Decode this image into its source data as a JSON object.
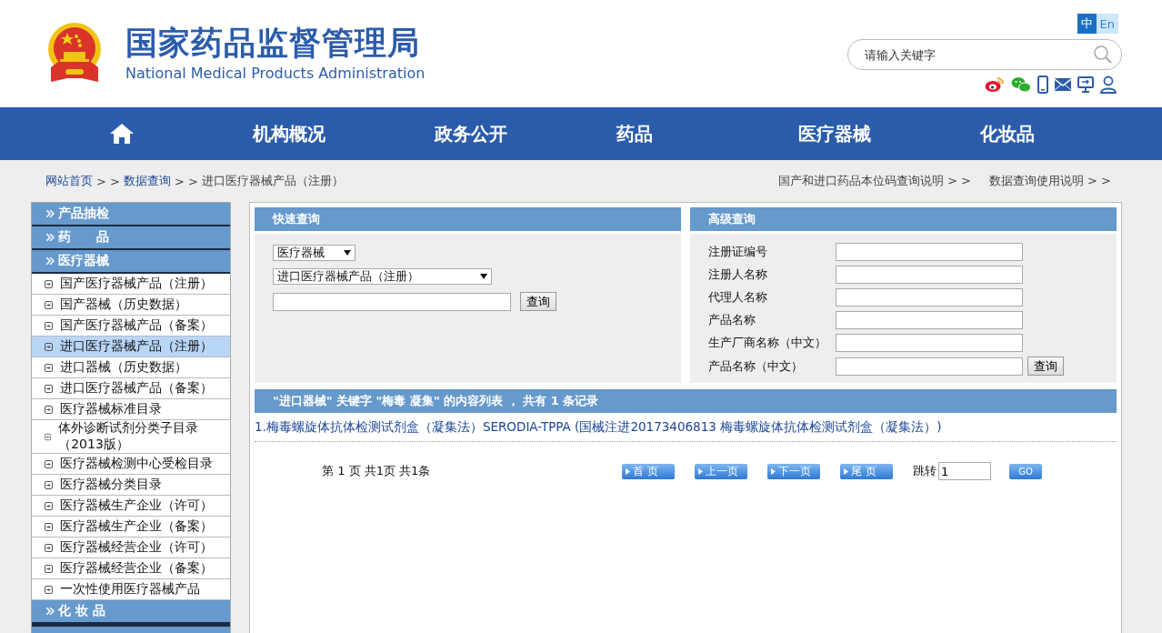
{
  "header": {
    "title": "国家药品监督管理局",
    "subtitle": "National Medical Products Administration",
    "languages": [
      {
        "label": "中",
        "selected": true
      },
      {
        "label": "En",
        "selected": false
      }
    ],
    "search": {
      "placeholder": "请输入关键字"
    }
  },
  "nav": {
    "items": [
      {
        "label": "机构概况"
      },
      {
        "label": "政务公开"
      },
      {
        "label": "药品"
      },
      {
        "label": "医疗器械"
      },
      {
        "label": "化妆品"
      }
    ]
  },
  "breadcrumb": [
    {
      "label": "网站首页",
      "kind": "link",
      "suffix": "> >"
    },
    {
      "label": "数据查询",
      "kind": "link",
      "suffix": "> >"
    },
    {
      "label": "进口医疗器械产品（注册）",
      "kind": "current"
    }
  ],
  "help_links": [
    {
      "label": "国产和进口药品本位码查询说明 > >"
    },
    {
      "label": "数据查询使用说明 > >"
    }
  ],
  "sidebar": {
    "items": [
      {
        "kind": "category",
        "label": "产品抽检"
      },
      {
        "kind": "category",
        "label": "药　　品"
      },
      {
        "kind": "category",
        "label": "医疗器械"
      },
      {
        "kind": "link",
        "label": "国产医疗器械产品（注册）",
        "selected": false
      },
      {
        "kind": "link",
        "label": "国产器械（历史数据）",
        "selected": false
      },
      {
        "kind": "link",
        "label": "国产医疗器械产品（备案）",
        "selected": false
      },
      {
        "kind": "link",
        "label": "进口医疗器械产品（注册）",
        "selected": true
      },
      {
        "kind": "link",
        "label": "进口器械（历史数据）",
        "selected": false
      },
      {
        "kind": "link",
        "label": "进口医疗器械产品（备案）",
        "selected": false
      },
      {
        "kind": "link",
        "label": "医疗器械标准目录",
        "selected": false
      },
      {
        "kind": "link",
        "label": "体外诊断试剂分类子目录（2013版）",
        "selected": false
      },
      {
        "kind": "link",
        "label": "医疗器械检测中心受检目录",
        "selected": false
      },
      {
        "kind": "link",
        "label": "医疗器械分类目录",
        "selected": false
      },
      {
        "kind": "link",
        "label": "医疗器械生产企业（许可）",
        "selected": false
      },
      {
        "kind": "link",
        "label": "医疗器械生产企业（备案）",
        "selected": false
      },
      {
        "kind": "link",
        "label": "医疗器械经营企业（许可）",
        "selected": false
      },
      {
        "kind": "link",
        "label": "医疗器械经营企业（备案）",
        "selected": false
      },
      {
        "kind": "link",
        "label": "一次性使用医疗器械产品",
        "selected": false
      },
      {
        "kind": "category",
        "label": "化 妆 品"
      }
    ]
  },
  "quick_search": {
    "title": "快速查询",
    "category": "医疗器械",
    "subcategory": "进口医疗器械产品（注册）",
    "button": "查询"
  },
  "advanced_search": {
    "title": "高级查询",
    "fields": [
      {
        "label": "注册证编号"
      },
      {
        "label": "注册人名称"
      },
      {
        "label": "代理人名称"
      },
      {
        "label": "产品名称"
      },
      {
        "label": "生产厂商名称（中文）"
      },
      {
        "label": "产品名称（中文）"
      }
    ],
    "button": "查询"
  },
  "results": {
    "title": "\"进口器械\" 关键字 \"梅毒 凝集\" 的内容列表 ， 共有 1 条记录",
    "items": [
      "1.梅毒螺旋体抗体检测试剂盒（凝集法）SERODIA-TPPA (国械注进20173406813 梅毒螺旋体抗体检测试剂盒（凝集法）)"
    ],
    "pagination": {
      "summary": "第 1 页 共1页 共1条",
      "buttons": [
        "首 页",
        "上一页",
        "下一页",
        "尾 页"
      ],
      "jump_label": "跳转",
      "jump_value": "1",
      "go": "GO"
    }
  }
}
